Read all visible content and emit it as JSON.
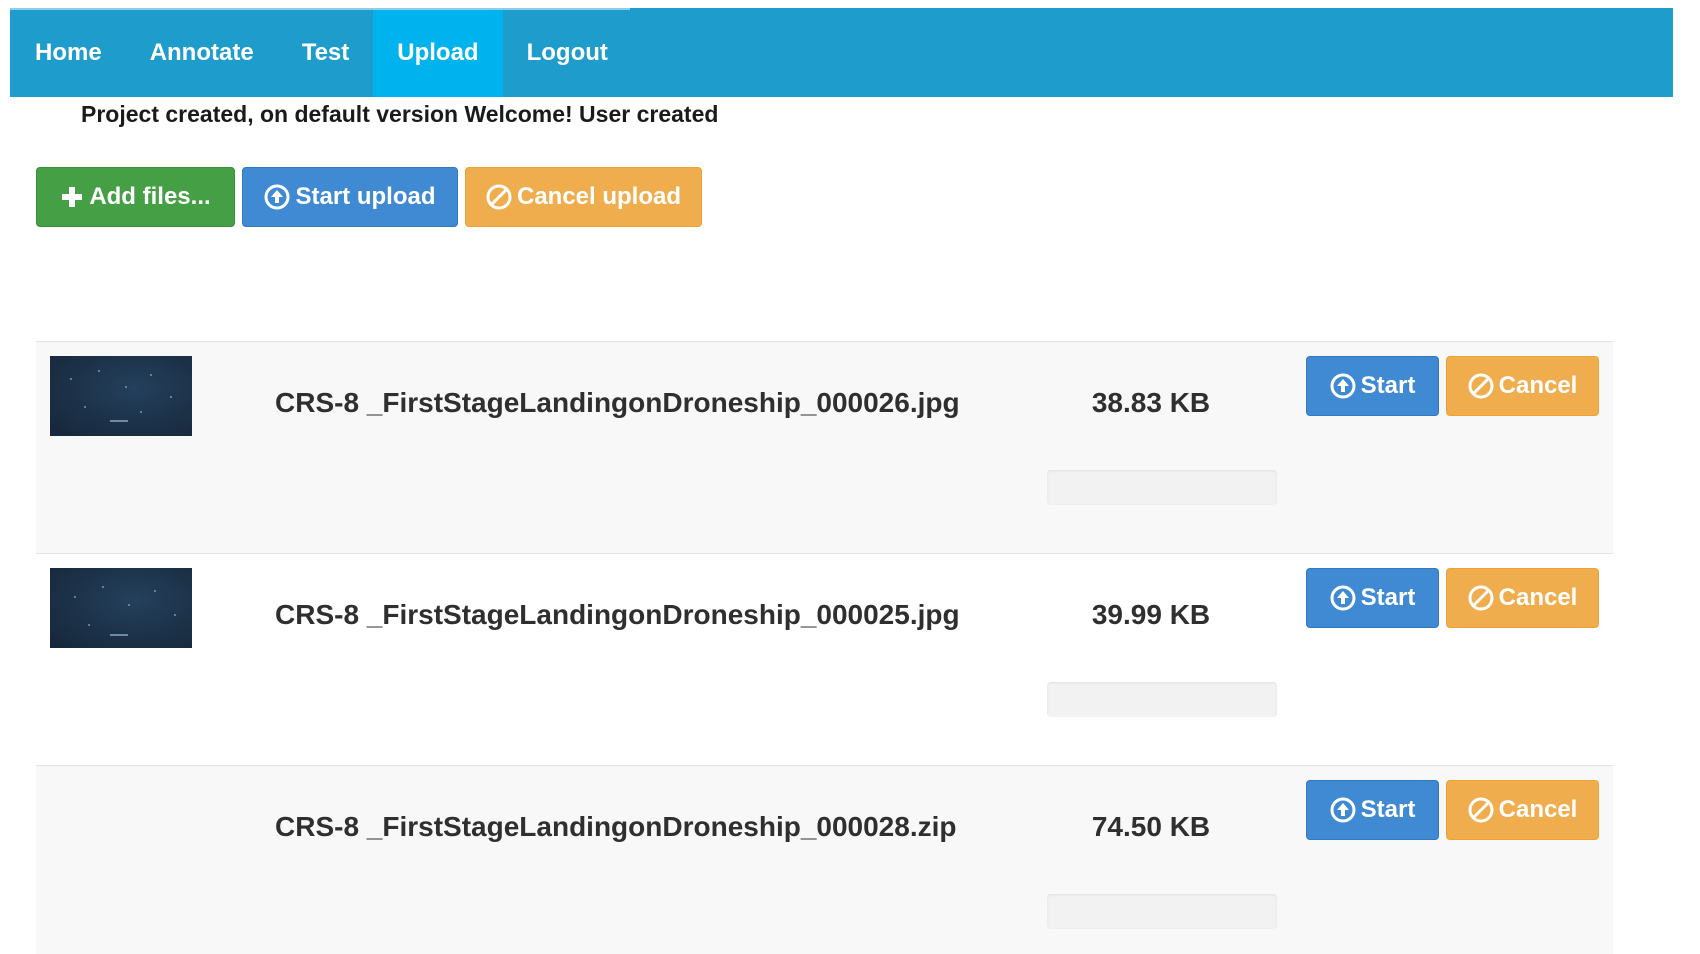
{
  "nav": {
    "items": [
      {
        "label": "Home",
        "active": false
      },
      {
        "label": "Annotate",
        "active": false
      },
      {
        "label": "Test",
        "active": false
      },
      {
        "label": "Upload",
        "active": true
      },
      {
        "label": "Logout",
        "active": false
      }
    ],
    "color": "#1e9ccc",
    "active_color": "#00b2ee"
  },
  "status_message": "Project created, on default version Welcome! User created",
  "toolbar": {
    "add_files_label": "Add files...",
    "add_files_icon": "plus-icon",
    "start_upload_label": "Start upload",
    "start_upload_icon": "circle-arrow-up-icon",
    "cancel_upload_label": "Cancel upload",
    "cancel_upload_icon": "ban-circle-icon"
  },
  "files": [
    {
      "name": "CRS-8 _FirstStageLandingonDroneship_000026.jpg",
      "size": "38.83 KB",
      "has_thumbnail": true,
      "progress": 0,
      "start_label": "Start",
      "cancel_label": "Cancel"
    },
    {
      "name": "CRS-8 _FirstStageLandingonDroneship_000025.jpg",
      "size": "39.99 KB",
      "has_thumbnail": true,
      "progress": 0,
      "start_label": "Start",
      "cancel_label": "Cancel"
    },
    {
      "name": "CRS-8 _FirstStageLandingonDroneship_000028.zip",
      "size": "74.50 KB",
      "has_thumbnail": false,
      "progress": 0,
      "start_label": "Start",
      "cancel_label": "Cancel"
    }
  ],
  "colors": {
    "success": "#45a045",
    "primary": "#3f8ad3",
    "warning": "#f0ad4e"
  }
}
